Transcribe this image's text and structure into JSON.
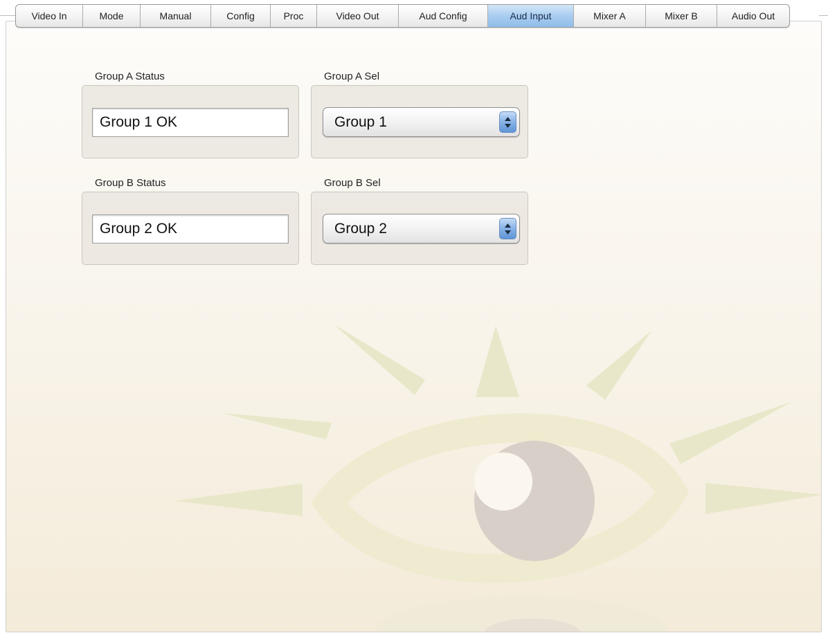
{
  "tabs": [
    {
      "label": "Video In",
      "active": false
    },
    {
      "label": "Mode",
      "active": false
    },
    {
      "label": "Manual",
      "active": false
    },
    {
      "label": "Config",
      "active": false
    },
    {
      "label": "Proc",
      "active": false
    },
    {
      "label": "Video Out",
      "active": false
    },
    {
      "label": "Aud Config",
      "active": false
    },
    {
      "label": "Aud Input",
      "active": true
    },
    {
      "label": "Mixer A",
      "active": false
    },
    {
      "label": "Mixer B",
      "active": false
    },
    {
      "label": "Audio Out",
      "active": false
    }
  ],
  "group_a": {
    "status_label": "Group A Status",
    "status_value": "Group 1 OK",
    "sel_label": "Group A Sel",
    "sel_value": "Group 1"
  },
  "group_b": {
    "status_label": "Group B Status",
    "status_value": "Group 2 OK",
    "sel_label": "Group B Sel",
    "sel_value": "Group 2"
  },
  "colors": {
    "active_tab": "#a9cdf1",
    "watermark_rays": "#e8e6c8",
    "watermark_eye": "#efeccf",
    "watermark_iris": "#d6cfc6"
  }
}
